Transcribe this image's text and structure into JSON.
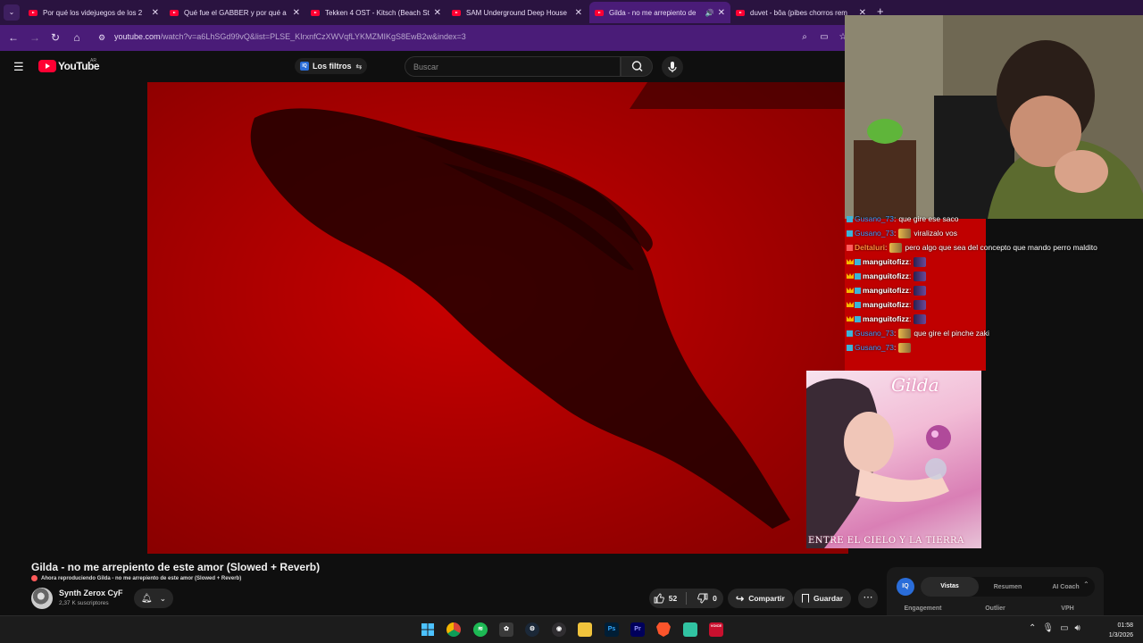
{
  "browser": {
    "tabs": [
      {
        "title": "Por qué los videjuegos de los 2",
        "active": false
      },
      {
        "title": "Qué fue el GABBER y por qué a",
        "active": false
      },
      {
        "title": "Tekken 4 OST - Kitsch (Beach St",
        "active": false
      },
      {
        "title": "SAM Underground Deep House",
        "active": false
      },
      {
        "title": "Gilda - no me arrepiento de",
        "active": true
      },
      {
        "title": "duvet - bôa (pibes chorros rem",
        "active": false
      }
    ],
    "url_host": "youtube.com",
    "url_path": "/watch?v=a6LhSGd99vQ&list=PLSE_KIrxnfCzXWVqfLYKMZMIKgS8EwB2w&index=3"
  },
  "youtube": {
    "logo_text": "YouTube",
    "country_code": "AR",
    "filters_label": "Los filtros",
    "filters_badge": "IQ",
    "search_placeholder": "Buscar"
  },
  "chat": [
    {
      "user": "Gusano_73",
      "text": "que gire ese saco",
      "style": "link",
      "crown": false
    },
    {
      "user": "Gusano_73",
      "text": "viralizalo vos",
      "style": "link",
      "crown": false,
      "emote": true
    },
    {
      "user": "Deltaluri",
      "text": "pero algo que sea del concepto que mando perro maldito",
      "style": "orange",
      "crown": false,
      "emote": true
    },
    {
      "user": "manguitofizz",
      "text": "",
      "style": "bold",
      "crown": true,
      "emote": true
    },
    {
      "user": "manguitofizz",
      "text": "",
      "style": "bold",
      "crown": true,
      "emote": true
    },
    {
      "user": "manguitofizz",
      "text": "",
      "style": "bold",
      "crown": true,
      "emote": true
    },
    {
      "user": "manguitofizz",
      "text": "",
      "style": "bold",
      "crown": true,
      "emote": true
    },
    {
      "user": "manguitofizz",
      "text": "",
      "style": "bold",
      "crown": true,
      "emote": true
    },
    {
      "user": "Gusano_73",
      "text": "que gire el pinche zaki",
      "style": "link",
      "crown": false,
      "emote": true
    },
    {
      "user": "Gusano_73",
      "text": "",
      "style": "link",
      "crown": false,
      "emote": true
    }
  ],
  "album": {
    "title": "Gilda",
    "subtitle": "ENTRE EL CIELO Y LA TIERRA"
  },
  "video": {
    "title": "Gilda - no me arrepiento de este amor (Slowed + Reverb)",
    "now_playing": "Ahora reproduciendo Gilda - no me arrepiento de este amor (Slowed + Reverb)",
    "channel_name": "Synth Zerox CyF",
    "subscribers": "2,37 K suscriptores",
    "likes": "52",
    "dislikes": "0",
    "share_label": "Compartir",
    "save_label": "Guardar"
  },
  "iq_widget": {
    "logo": "IQ",
    "tabs": [
      "Vistas",
      "Resumen",
      "AI Coach"
    ],
    "active_tab": "Vistas",
    "metrics": [
      "Engagement",
      "Outlier",
      "VPH"
    ]
  },
  "taskbar": {
    "apps": [
      "Start",
      "Chrome",
      "Spotify",
      "App",
      "Steam",
      "Obs",
      "Explorer",
      "Ps",
      "Pr",
      "Brave",
      "Streamlabs",
      "Voice"
    ],
    "time": "01:58",
    "date": "1/3/2026"
  },
  "colors": {
    "tabstrip": "#2a1340",
    "toolbar": "#4a1c78",
    "video_red": "#b00000",
    "yt_red": "#ff0033",
    "chat_link": "#3b9bff",
    "chat_orange": "#ff8c3a"
  }
}
